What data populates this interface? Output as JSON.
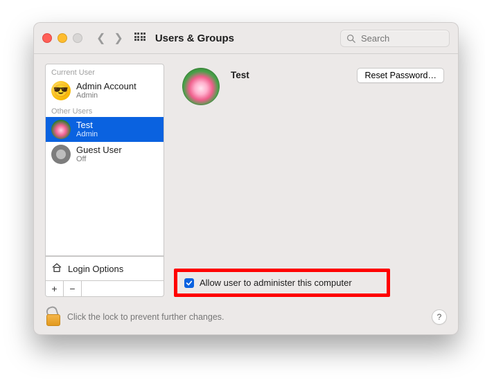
{
  "window": {
    "title": "Users & Groups"
  },
  "search": {
    "placeholder": "Search"
  },
  "sidebar": {
    "current_user_label": "Current User",
    "other_users_label": "Other Users",
    "users": [
      {
        "name": "Admin Account",
        "role": "Admin"
      },
      {
        "name": "Test",
        "role": "Admin"
      },
      {
        "name": "Guest User",
        "role": "Off"
      }
    ],
    "login_options_label": "Login Options"
  },
  "main": {
    "selected_user_name": "Test",
    "reset_password_label": "Reset Password…",
    "allow_admin_label": "Allow user to administer this computer",
    "allow_admin_checked": true
  },
  "footer": {
    "lock_hint": "Click the lock to prevent further changes.",
    "help_label": "?"
  }
}
